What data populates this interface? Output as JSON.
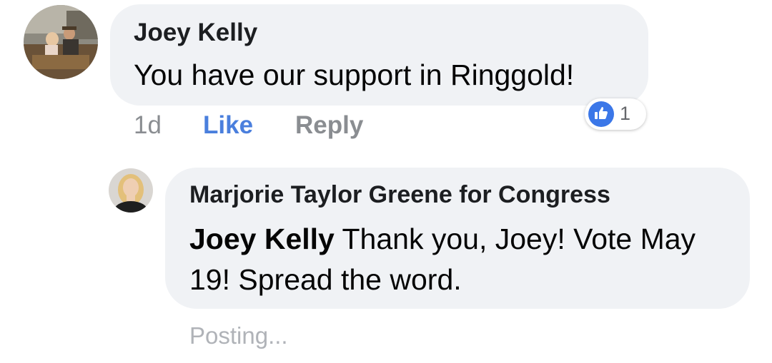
{
  "comment": {
    "author": "Joey Kelly",
    "text": "You have our support in Ringgold!",
    "time": "1d",
    "like_label": "Like",
    "reply_label": "Reply",
    "reaction_count": "1",
    "reaction_icon": "thumbs-up-icon"
  },
  "reply": {
    "author": "Marjorie Taylor Greene for Congress",
    "mention": "Joey Kelly",
    "text": " Thank you, Joey! Vote May 19! Spread the word.",
    "status": "Posting..."
  },
  "colors": {
    "bubble": "#f0f2f5",
    "like_blue": "#4a7fdd",
    "meta_gray": "#8a8d91",
    "reaction_blue": "#3b77e8"
  }
}
